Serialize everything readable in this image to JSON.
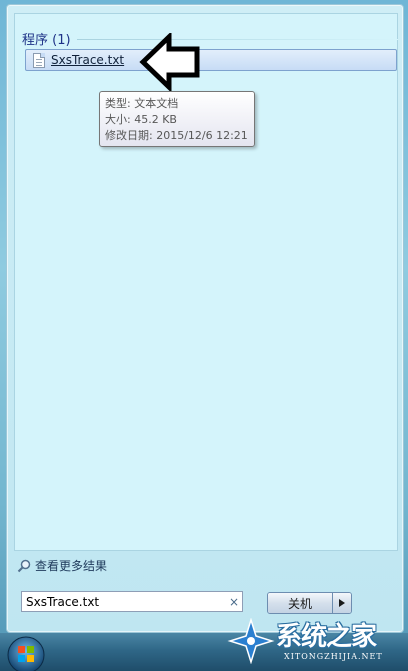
{
  "results": {
    "group_title": "程序 (1)",
    "items": [
      {
        "label": "SxsTrace.txt",
        "icon": "text-file-icon"
      }
    ]
  },
  "tooltip": {
    "type_line": "类型: 文本文档",
    "size_line": "大小: 45.2 KB",
    "modified_line": "修改日期: 2015/12/6 12:21"
  },
  "see_more": {
    "label": "查看更多结果",
    "icon": "search-icon"
  },
  "search": {
    "value": "SxsTrace.txt",
    "clear_icon": "×"
  },
  "shutdown": {
    "label": "关机",
    "arrow_icon": "▶"
  },
  "watermark": {
    "text": "系统之家",
    "url": "XITONGZHIJIA.NET"
  },
  "colors": {
    "accent": "#1e3287",
    "selection_bg": "#c7dcf5",
    "results_bg": "#d4f4fb"
  }
}
